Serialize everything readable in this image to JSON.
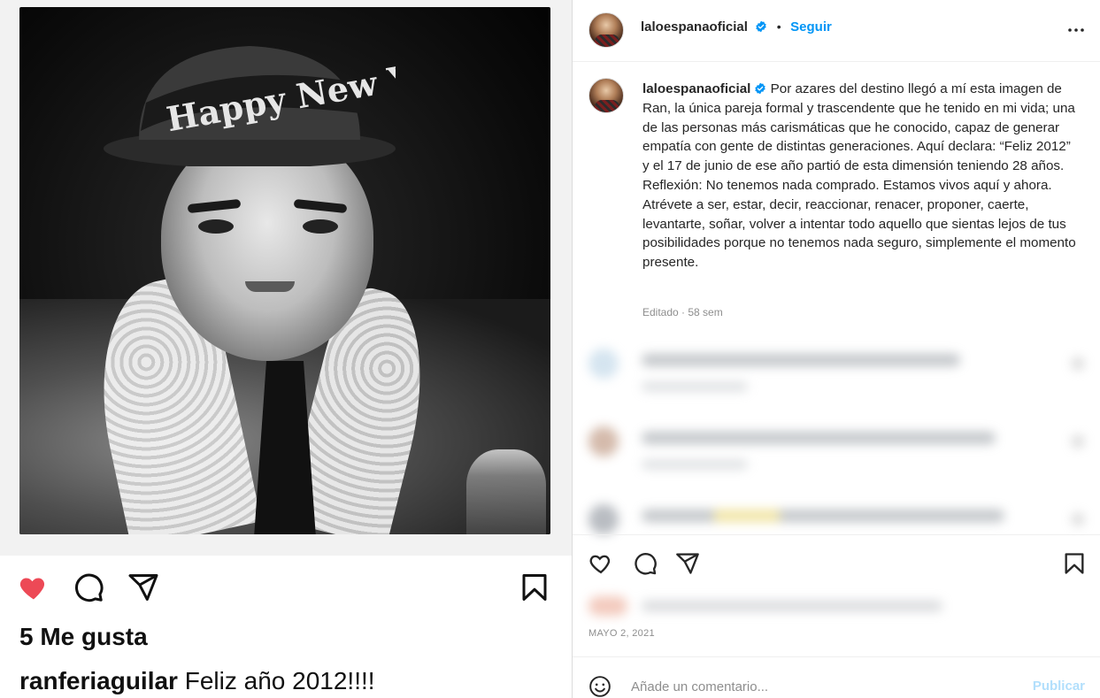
{
  "left_post": {
    "hat_text": "Happy New Year",
    "likes": "5 Me gusta",
    "caption_user": "ranferiaguilar",
    "caption_text": "Feliz año 2012!!!!"
  },
  "header": {
    "username": "laloespanaoficial",
    "dot": "•",
    "follow_label": "Seguir"
  },
  "caption": {
    "username": "laloespanaoficial",
    "text": "Por azares del destino llegó a mí esta imagen de Ran, la única pareja formal y trascendente que he tenido en mi vida; una de las personas más carismáticas que he conocido, capaz de generar empatía con gente de distintas generaciones. Aquí declara: “Feliz 2012” y el 17 de junio de ese año partió de esta dimensión teniendo 28 años. Reflexión: No tenemos nada comprado. Estamos vivos aquí y ahora. Atrévete a ser, estar, decir, reaccionar, renacer, proponer, caerte, levantarte, soñar, volver a intentar todo aquello que sientas lejos de tus posibilidades porque no tenemos nada seguro, simplemente el momento presente.",
    "meta": "Editado · 58 sem"
  },
  "post": {
    "date": "MAYO 2, 2021"
  },
  "composer": {
    "placeholder": "Añade un comentario...",
    "publish_label": "Publicar"
  },
  "icons": {
    "like": "heart-icon",
    "comment": "comment-icon",
    "share": "share-icon",
    "save": "bookmark-icon",
    "more": "more-options-icon",
    "emoji": "emoji-icon",
    "verified": "verified-badge-icon"
  },
  "colors": {
    "accent": "#0095f6",
    "liked": "#ed4956",
    "publish_disabled": "#b2dffc"
  }
}
